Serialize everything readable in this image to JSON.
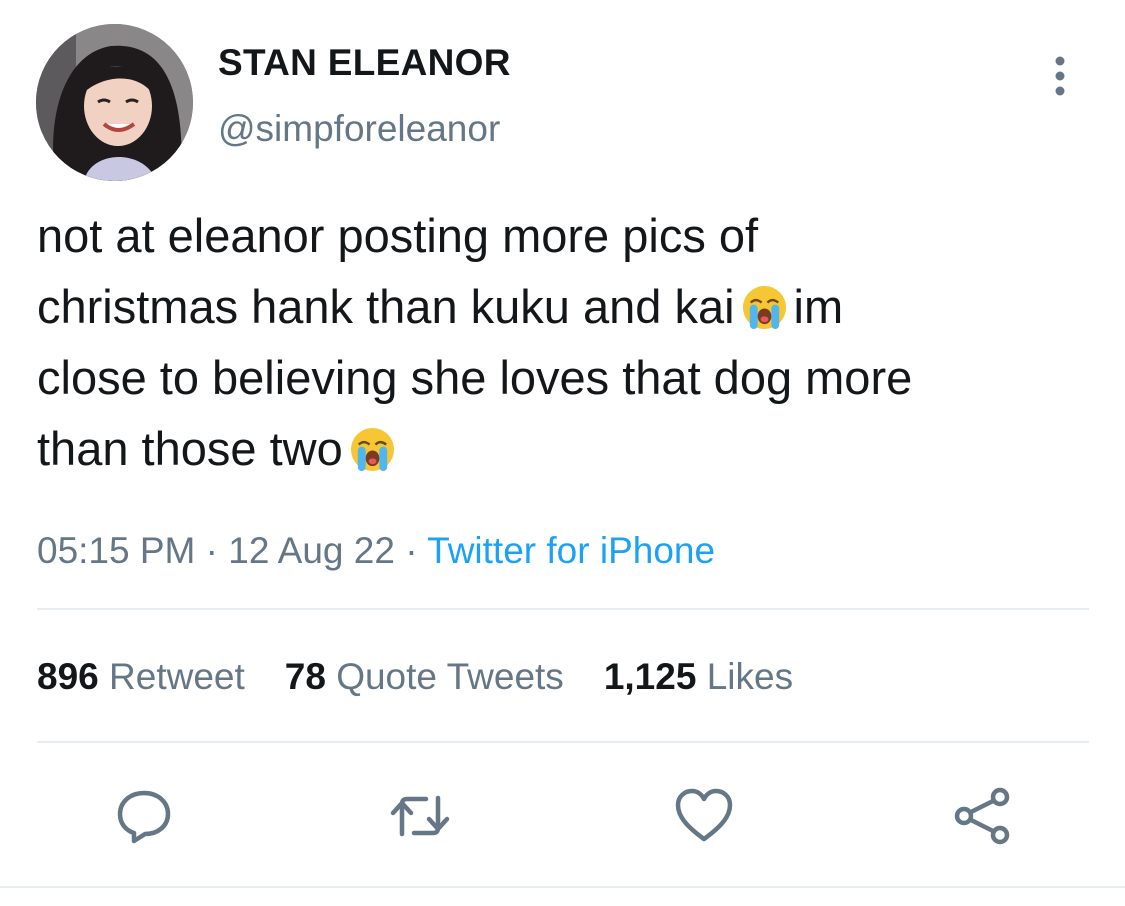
{
  "user": {
    "display_name": "STAN ELEANOR",
    "handle": "@simpforeleanor",
    "avatar_icon": "profile-photo"
  },
  "tweet": {
    "lines": [
      "not at eleanor posting more pics of",
      "christmas hank than kuku and kai",
      "im",
      "close to believing she loves that dog more",
      "than those two"
    ],
    "emoji": "loudly-crying-face"
  },
  "meta": {
    "time": "05:15 PM",
    "sep1": " · ",
    "date": "12 Aug 22",
    "sep2": " · ",
    "source": "Twitter for iPhone"
  },
  "stats": {
    "retweets": {
      "count": "896",
      "label": "Retweet"
    },
    "quotes": {
      "count": "78",
      "label": "Quote Tweets"
    },
    "likes": {
      "count": "1,125",
      "label": "Likes"
    }
  },
  "icons": {
    "more": "more-vertical-icon",
    "reply": "reply-icon",
    "retweet": "retweet-icon",
    "like": "heart-icon",
    "share": "share-icon"
  },
  "colors": {
    "text": "#14171a",
    "secondary": "#657786",
    "link": "#1da1f2",
    "divider": "#e6ecf0"
  }
}
